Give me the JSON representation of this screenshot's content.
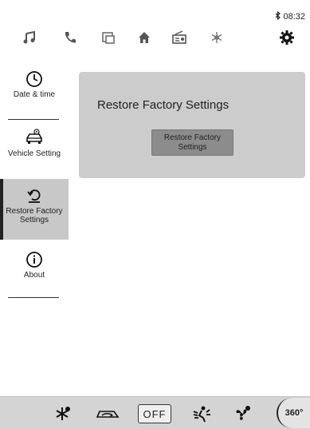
{
  "status": {
    "bluetooth_icon": "bluetooth-icon",
    "time": "08:32"
  },
  "topnav": {
    "items": [
      {
        "name": "music-icon"
      },
      {
        "name": "phone-icon"
      },
      {
        "name": "apps-icon"
      },
      {
        "name": "home-icon"
      },
      {
        "name": "radio-icon"
      },
      {
        "name": "climate-icon"
      },
      {
        "name": "settings-icon",
        "active": true
      }
    ]
  },
  "sidebar": {
    "items": [
      {
        "label": "Date & time",
        "icon": "clock-icon"
      },
      {
        "label": "Vehicle Setting",
        "icon": "car-settings-icon"
      },
      {
        "label": "Restore Factory Settings",
        "icon": "restore-icon",
        "active": true
      },
      {
        "label": "About",
        "icon": "info-icon"
      }
    ]
  },
  "panel": {
    "title": "Restore Factory Settings",
    "button_label": "Restore Factory Settings"
  },
  "bottombar": {
    "items": [
      {
        "name": "defrost-icon"
      },
      {
        "name": "recirculation-icon"
      },
      {
        "label": "OFF"
      },
      {
        "name": "airflow-icon"
      },
      {
        "name": "fan-icon"
      },
      {
        "label": "360°"
      }
    ]
  }
}
